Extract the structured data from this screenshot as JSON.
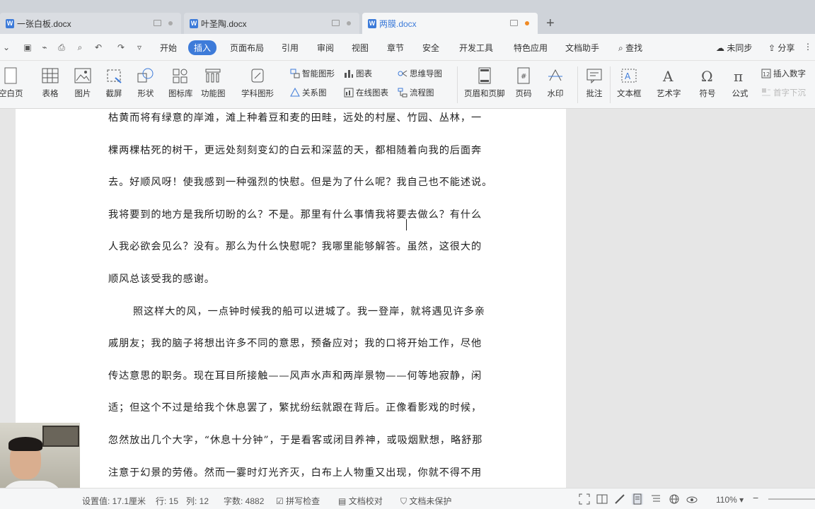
{
  "tabs": [
    {
      "label": "一张白板.docx"
    },
    {
      "label": "叶圣陶.docx"
    },
    {
      "label": "两膜.docx",
      "active": true
    }
  ],
  "menu": {
    "items": [
      "开始",
      "插入",
      "页面布局",
      "引用",
      "审阅",
      "视图",
      "章节",
      "安全",
      "开发工具",
      "特色应用",
      "文档助手"
    ],
    "active": "插入",
    "search": "查找",
    "sync": "未同步",
    "share": "分享"
  },
  "toolbar": {
    "blank_page": "空白页",
    "table": "表格",
    "picture": "图片",
    "screenshot": "截屏",
    "shape": "形状",
    "icon_lib": "图标库",
    "func_chart": "功能图",
    "subject_shape": "学科图形",
    "smart_shape": "智能图形",
    "chart": "图表",
    "mindmap": "思维导图",
    "relation": "关系图",
    "online_chart": "在线图表",
    "flowchart": "流程图",
    "header_footer": "页眉和页脚",
    "page_number": "页码",
    "watermark": "水印",
    "comment": "批注",
    "textbox": "文本框",
    "wordart": "艺术字",
    "symbol": "符号",
    "formula": "公式",
    "insert_number": "插入数字",
    "drop_cap": "首字下沉"
  },
  "document": {
    "lines": [
      {
        "text": "枯黄而将有绿意的岸滩，滩上种着豆和麦的田畦，远处的村屋、竹园、丛林，一",
        "indent": false
      },
      {
        "text": "棵两棵枯死的树干，更远处刻刻变幻的白云和深蓝的天，都相随着向我的后面奔",
        "indent": false
      },
      {
        "text": "去。好顺风呀！使我感到一种强烈的快慰。但是为了什么呢？我自己也不能述说。",
        "indent": false
      },
      {
        "text": "我将要到的地方是我所切盼的么？不是。那里有什么事情我将要去做么？有什么",
        "indent": false
      },
      {
        "text": "人我必欲会见么？没有。那么为什么快慰呢？我哪里能够解答。虽然，这很大的",
        "indent": false
      },
      {
        "text": "顺风总该受我的感谢。",
        "indent": false
      },
      {
        "text": "照这样大的风，一点钟时候我的船可以进城了。我一登岸，就将遇见许多亲",
        "indent": true
      },
      {
        "text": "戚朋友；我的脑子将想出许多不同的意思，预备应对；我的口将开始工作，尽他",
        "indent": false
      },
      {
        "text": "传达意思的职务。现在耳目所接触——风声水声和两岸景物——何等地寂静，闲",
        "indent": false
      },
      {
        "text": "适；但这个不过是给我个休息罢了，繁扰纷纭就跟在背后。正像看影戏的时候，",
        "indent": false
      },
      {
        "text": "忽然放出几个大字，“休息十分钟”，于是看客或闭目养神，或吸烟默想，略舒那",
        "indent": false
      },
      {
        "text": "注意于幻景的劳倦。然而一霎时灯光齐灭，白布上人物重又出现，你就不得不用",
        "indent": false
      }
    ]
  },
  "status": {
    "setting": "设置值: 17.1厘米",
    "row": "行: 15",
    "col": "列: 12",
    "words": "字数: 4882",
    "spell": "拼写检查",
    "proof": "文档校对",
    "protect": "文档未保护",
    "zoom": "110%"
  }
}
